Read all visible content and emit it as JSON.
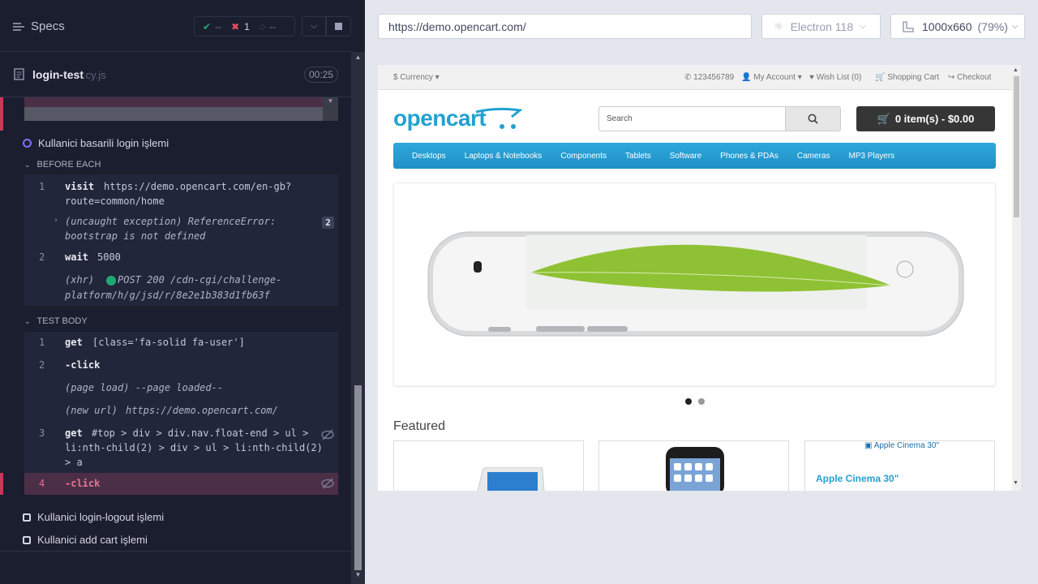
{
  "runner": {
    "specs_label": "Specs",
    "stats": {
      "passed": "--",
      "failed": "1",
      "pending": "--"
    },
    "file": {
      "name": "login-test",
      "ext": ".cy.js",
      "timer": "00:25"
    },
    "tests": [
      {
        "label": "Kullanici basarili login işlemi"
      },
      {
        "label": "Kullanici login-logout işlemi"
      },
      {
        "label": "Kullanici add cart işlemi"
      }
    ],
    "sections": {
      "before_each": "BEFORE EACH",
      "test_body": "TEST BODY"
    },
    "before_each": {
      "c1_num": "1",
      "c1_cmd": "visit",
      "c1_msg_a": "https://demo.opencart.com/en-gb?",
      "c1_msg_b": "route=common/home",
      "exc_a": "(uncaught exception)  ReferenceError:",
      "exc_b": "bootstrap is not defined",
      "exc_count": "2",
      "c2_num": "2",
      "c2_cmd": "wait",
      "c2_msg": "5000",
      "xhr_label": "(xhr)",
      "xhr_msg_a": "POST 200 /cdn-cgi/challenge-",
      "xhr_msg_b": "platform/h/g/jsd/r/8e2e1b383d1fb63f"
    },
    "test_body": {
      "c1_num": "1",
      "c1_cmd": "get",
      "c1_msg": "[class='fa-solid fa-user']",
      "c2_num": "2",
      "c2_cmd": "-click",
      "page_load": "(page load)  --page loaded--",
      "new_url_label": "(new url)",
      "new_url": "https://demo.opencart.com/",
      "c3_num": "3",
      "c3_cmd": "get",
      "c3_msg_a": "#top > div > div.nav.float-end > ul >",
      "c3_msg_b": "li:nth-child(2) > div > ul > li:nth-child(2)",
      "c3_msg_c": "> a",
      "c4_num": "4",
      "c4_cmd": "-click"
    }
  },
  "browser": {
    "url": "https://demo.opencart.com/",
    "browser_name": "Electron 118",
    "viewport": "1000x660",
    "zoom": "(79%)"
  },
  "site": {
    "currency": "$ Currency",
    "phone": "123456789",
    "my_account": "My Account",
    "wish_list": "Wish List (0)",
    "cart_link": "Shopping Cart",
    "checkout": "Checkout",
    "logo": "opencart",
    "search_placeholder": "Search",
    "cart_button": "0 item(s) - $0.00",
    "nav": [
      "Desktops",
      "Laptops & Notebooks",
      "Components",
      "Tablets",
      "Software",
      "Phones & PDAs",
      "Cameras",
      "MP3 Players"
    ],
    "featured_title": "Featured",
    "apple_alt": "Apple Cinema 30\"",
    "apple_name": "Apple Cinema 30\""
  },
  "colors": {
    "accent_fail": "#c73958",
    "brand_blue": "#23a1d1"
  }
}
